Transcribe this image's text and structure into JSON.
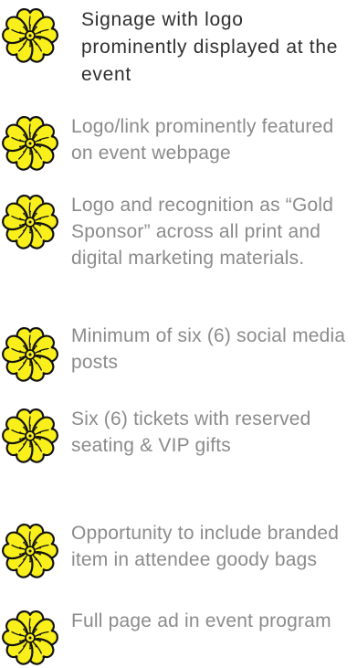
{
  "colors": {
    "petal_fill": "#f8ef1b",
    "petal_stroke": "#111111",
    "heading_text": "#2f2f2f",
    "body_text": "#8b8b8b",
    "background": "#ffffff"
  },
  "icons": {
    "bullet": "flower-icon"
  },
  "benefits": [
    {
      "text": "Signage with logo prominently displayed at the event"
    },
    {
      "text": "Logo/link prominently featured on event webpage"
    },
    {
      "text": "Logo and recognition as “Gold Sponsor” across all print and digital marketing materials."
    },
    {
      "text": "Minimum of six (6) social media posts"
    },
    {
      "text": "Six (6) tickets with reserved seating & VIP gifts"
    },
    {
      "text": "Opportunity to include branded item in attendee goody bags"
    },
    {
      "text": "Full page ad in event program"
    }
  ]
}
